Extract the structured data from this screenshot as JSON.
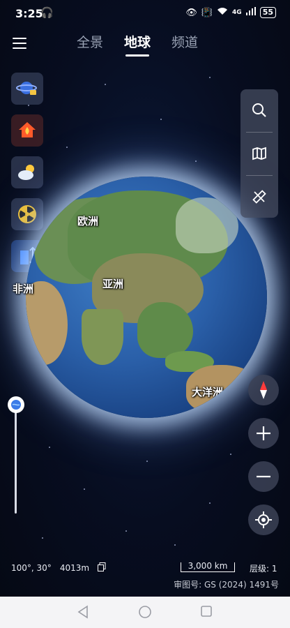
{
  "status": {
    "time": "3:25",
    "signal": "4G",
    "battery": "55"
  },
  "tabs": [
    {
      "label": "全景",
      "active": false
    },
    {
      "label": "地球",
      "active": true
    },
    {
      "label": "频道",
      "active": false
    }
  ],
  "left_tools": [
    "planet-icon",
    "fire-alert-icon",
    "weather-icon",
    "radiation-icon",
    "building-height-icon"
  ],
  "globe": {
    "labels": {
      "europe": "欧洲",
      "asia": "亚洲",
      "africa": "非洲",
      "oceania": "大洋洲"
    }
  },
  "right_tools": [
    "search-icon",
    "map-icon",
    "ruler-icon"
  ],
  "bottom": {
    "coords": "100°, 30°",
    "altitude": "4013m",
    "scale": "3,000 km",
    "level": "层级: 1",
    "approval": "审图号: GS (2024) 1491号"
  },
  "zoom_slider_level": 0.0
}
